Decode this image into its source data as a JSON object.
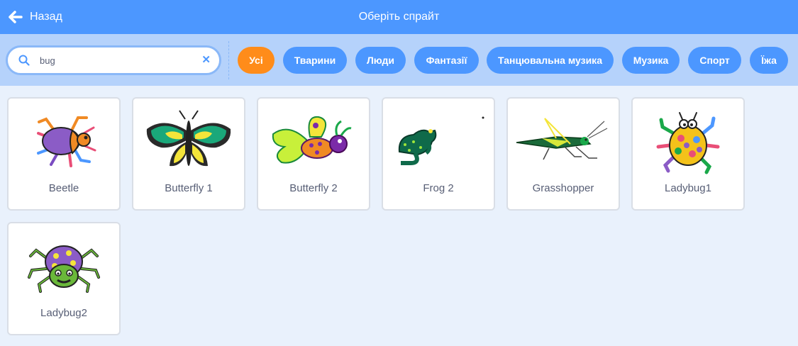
{
  "header": {
    "back_label": "Назад",
    "title": "Оберіть спрайт"
  },
  "search": {
    "value": "bug",
    "placeholder": ""
  },
  "tags": [
    {
      "label": "Усі",
      "active": true
    },
    {
      "label": "Тварини",
      "active": false
    },
    {
      "label": "Люди",
      "active": false
    },
    {
      "label": "Фантазії",
      "active": false
    },
    {
      "label": "Танцювальна музика",
      "active": false
    },
    {
      "label": "Музика",
      "active": false
    },
    {
      "label": "Спорт",
      "active": false
    },
    {
      "label": "Їжа",
      "active": false
    }
  ],
  "sprites": [
    {
      "name": "Beetle",
      "icon": "beetle-icon"
    },
    {
      "name": "Butterfly 1",
      "icon": "butterfly-icon"
    },
    {
      "name": "Butterfly 2",
      "icon": "butterfly-2-icon"
    },
    {
      "name": "Frog 2",
      "icon": "frog-icon"
    },
    {
      "name": "Grasshopper",
      "icon": "grasshopper-icon"
    },
    {
      "name": "Ladybug1",
      "icon": "ladybug-icon"
    },
    {
      "name": "Ladybug2",
      "icon": "ladybug-2-icon"
    }
  ],
  "colors": {
    "header": "#4c97ff",
    "filter_bar": "#b5d2fb",
    "active_tag": "#ff8c1a",
    "background": "#e9f1fc"
  }
}
